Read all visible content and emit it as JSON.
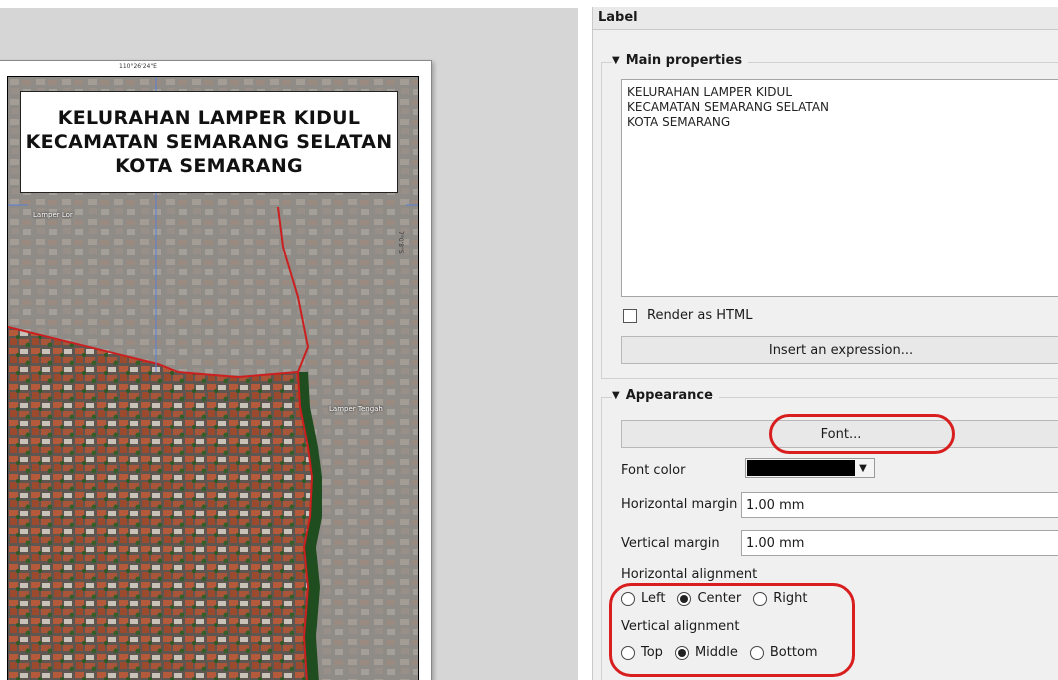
{
  "map": {
    "coord_top": "110°26'24\"E",
    "coord_right": "7°0'8\"S",
    "title_lines": [
      "KELURAHAN LAMPER KIDUL",
      "KECAMATAN SEMARANG SELATAN",
      "KOTA SEMARANG"
    ],
    "place_labels": {
      "lamper_lor": "Lamper Lor",
      "lamper_tengah": "Lamper Tengah"
    }
  },
  "panel": {
    "header": "Label",
    "main_properties": {
      "title": "Main properties",
      "label_text_lines": [
        "KELURAHAN LAMPER KIDUL",
        "KECAMATAN SEMARANG SELATAN",
        "KOTA SEMARANG"
      ],
      "render_as_html_label": "Render as HTML",
      "render_as_html_checked": false,
      "insert_expression_label": "Insert an expression..."
    },
    "appearance": {
      "title": "Appearance",
      "font_button_label": "Font...",
      "font_color_label": "Font color",
      "font_color_value": "#000000",
      "horizontal_margin_label": "Horizontal margin",
      "horizontal_margin_value": "1.00 mm",
      "vertical_margin_label": "Vertical margin",
      "vertical_margin_value": "1.00 mm",
      "horizontal_alignment_label": "Horizontal alignment",
      "horizontal_alignment_options": [
        "Left",
        "Center",
        "Right"
      ],
      "horizontal_alignment_selected": "Center",
      "vertical_alignment_label": "Vertical alignment",
      "vertical_alignment_options": [
        "Top",
        "Middle",
        "Bottom"
      ],
      "vertical_alignment_selected": "Middle"
    }
  },
  "colors": {
    "highlight": "#d81e1e",
    "boundary": "#cc1f1f",
    "vegetation": "#1f4d1f"
  }
}
